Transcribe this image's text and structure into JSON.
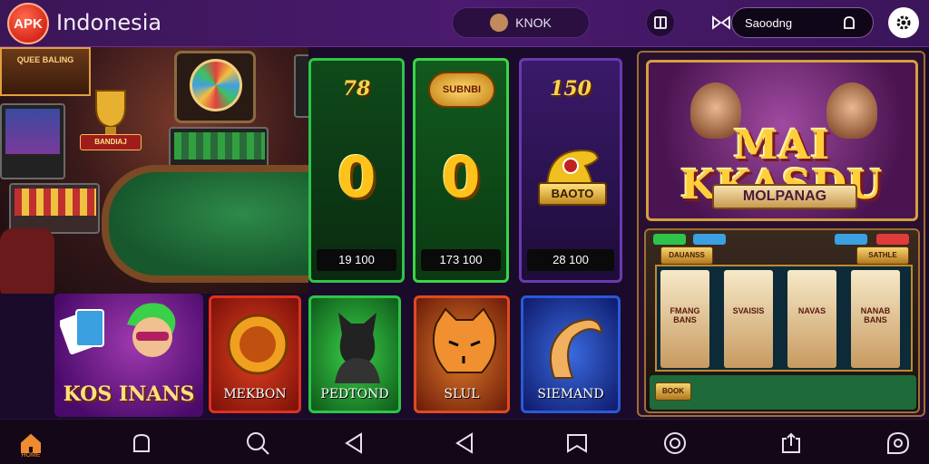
{
  "header": {
    "logo_text": "APK",
    "title": "Indonesia",
    "user_name": "KNOK",
    "search_value": "Saoodng"
  },
  "scene": {
    "sign_text": "QUEE BALING",
    "trophy_label": "BANDIAJ"
  },
  "score_cards": [
    {
      "head": "78",
      "value": "0",
      "foot": "19 100",
      "color": "#2ec44a"
    },
    {
      "head": "SUBNBI",
      "value": "0",
      "foot": "173 100",
      "color": "#3ad648"
    },
    {
      "head": "150",
      "value": "",
      "foot": "28 100",
      "badge": "BAOTO",
      "color": "#6a3ab0"
    }
  ],
  "feature": {
    "title_line1": "MAI",
    "title_line2": "KKASDU",
    "subtitle": "MOLPANAG",
    "reels": [
      "FMANG BANS",
      "SVAISIS",
      "NAVAS",
      "NANAB BANS"
    ],
    "tag_left": "DAUANSS",
    "tag_right": "SATHLE",
    "bottom_left": "BOOK"
  },
  "games": [
    {
      "label": "KOS INANS"
    },
    {
      "label": "MEKBON"
    },
    {
      "label": "PEDTOND"
    },
    {
      "label": "SLUL"
    },
    {
      "label": "SIEMAND"
    }
  ],
  "nav": {
    "home_label": "HOME",
    "items": [
      "home",
      "bag",
      "search",
      "back",
      "back",
      "bookmark",
      "search-zoom",
      "upload",
      "chat-search"
    ]
  },
  "colors": {
    "accent": "#f08a30",
    "topbar": "#4a1a6e",
    "gold": "#ffc21a"
  }
}
